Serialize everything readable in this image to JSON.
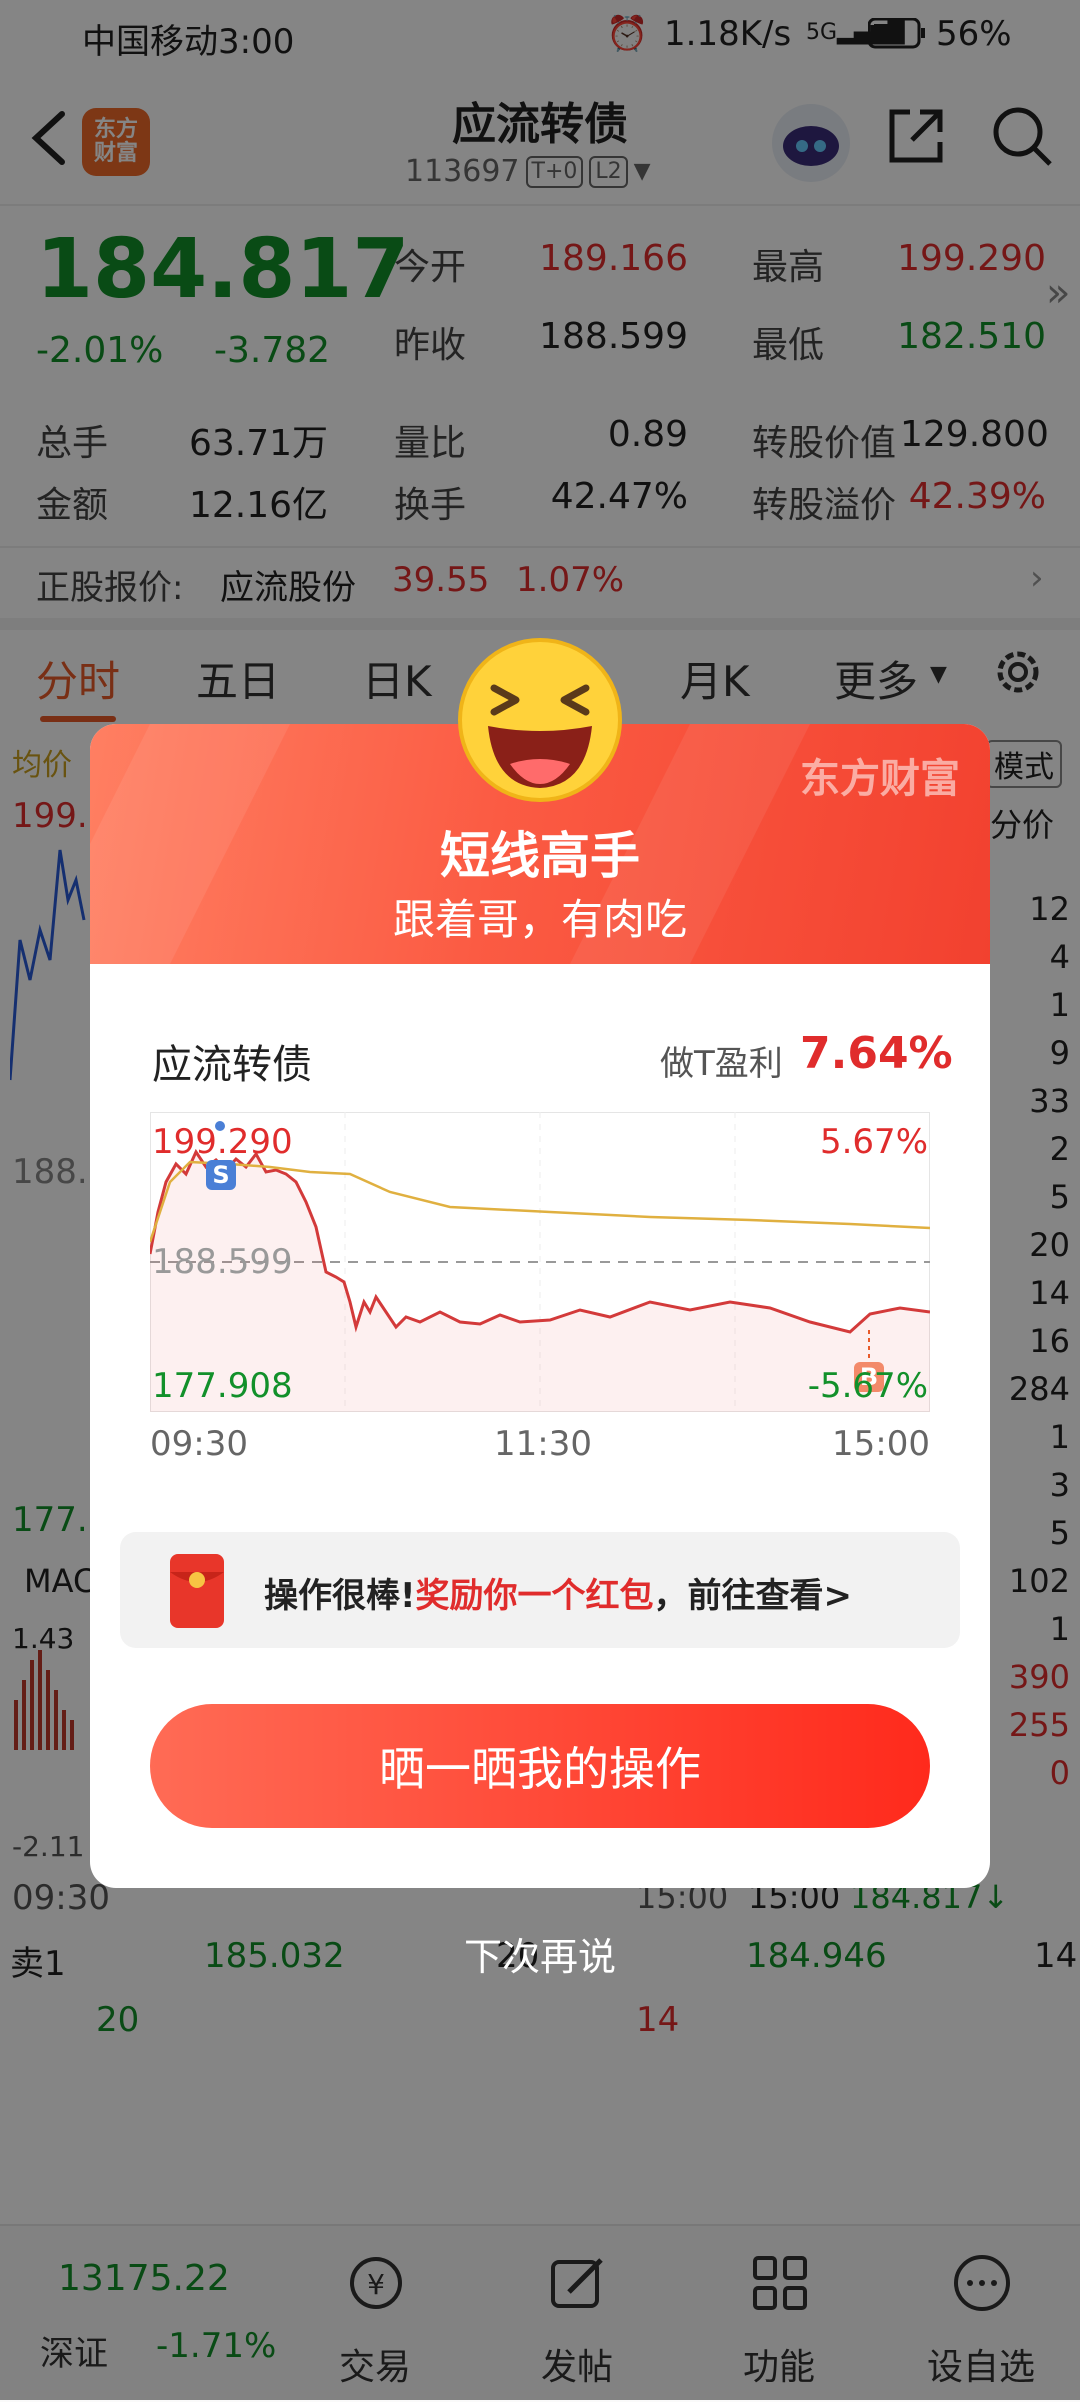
{
  "status_bar": {
    "carrier_time": "中国移动3:00",
    "speed": "1.18K/s",
    "battery": "56%"
  },
  "header": {
    "title": "应流转债",
    "code": "113697",
    "tags": [
      "T+0",
      "L2"
    ],
    "logo_text": "东方财富"
  },
  "quote": {
    "price": "184.817",
    "pct": "-2.01%",
    "change": "-3.782",
    "fields": [
      {
        "label": "今开",
        "value": "189.166",
        "tone": "red"
      },
      {
        "label": "最高",
        "value": "199.290",
        "tone": "red"
      },
      {
        "label": "昨收",
        "value": "188.599",
        "tone": "normal"
      },
      {
        "label": "最低",
        "value": "182.510",
        "tone": "green"
      },
      {
        "label": "总手",
        "value": "63.71万",
        "tone": "normal"
      },
      {
        "label": "量比",
        "value": "0.89",
        "tone": "normal"
      },
      {
        "label": "转股价值",
        "value": "129.800",
        "tone": "normal"
      },
      {
        "label": "金额",
        "value": "12.16亿",
        "tone": "normal"
      },
      {
        "label": "换手",
        "value": "42.47%",
        "tone": "normal"
      },
      {
        "label": "转股溢价",
        "value": "42.39%",
        "tone": "red"
      }
    ],
    "underlying": {
      "label": "正股报价:",
      "name": "应流股份",
      "price": "39.55",
      "pct": "1.07%"
    }
  },
  "tabs": [
    "分时",
    "五日",
    "日K",
    "月K",
    "更多"
  ],
  "background": {
    "left_labels": [
      "均价",
      "199.",
      "188.",
      "177.",
      "MAC",
      "1.43",
      "-2.11",
      "09:30"
    ],
    "right_labels": [
      "模式",
      "分价",
      "12",
      "4",
      "1",
      "9",
      "33",
      "2",
      "5",
      "20",
      "14",
      "16",
      "284",
      "1",
      "3",
      "5",
      "102",
      "1",
      "390",
      "255",
      "0"
    ],
    "bottom_time": "15:00",
    "bottom_price": "184.817↓",
    "bottom_end": "15:00",
    "sell1_label": "卖1",
    "sell1_price": "185.032",
    "sell1_qty": "20",
    "buy_price": "184.946",
    "buy_qty": "14",
    "qty_a": "20",
    "qty_b": "14"
  },
  "modal": {
    "brand": "东方财富",
    "title": "短线高手",
    "subtitle": "跟着哥，有肉吃",
    "bond": "应流转债",
    "profit_label": "做T盈利",
    "profit_value": "7.64%",
    "chart_labels": {
      "high": "199.290",
      "mid": "188.599",
      "low": "177.908",
      "up": "5.67%",
      "down": "-5.67%"
    },
    "times": [
      "09:30",
      "11:30",
      "15:00"
    ],
    "banner_prefix": "操作很棒!",
    "banner_highlight": "奖励你一个红包",
    "banner_suffix": "，前往查看>",
    "button": "晒一晒我的操作",
    "dismiss": "下次再说"
  },
  "bottom_nav": {
    "index_value": "13175.22",
    "index_name": "深证",
    "index_pct": "-1.71%",
    "items": [
      "交易",
      "发帖",
      "功能",
      "设自选"
    ]
  },
  "colors": {
    "accent_red": "#e02c2c",
    "up_green": "#12902a",
    "modal_gradient_start": "#ff7f62",
    "modal_gradient_end": "#f2412f"
  }
}
